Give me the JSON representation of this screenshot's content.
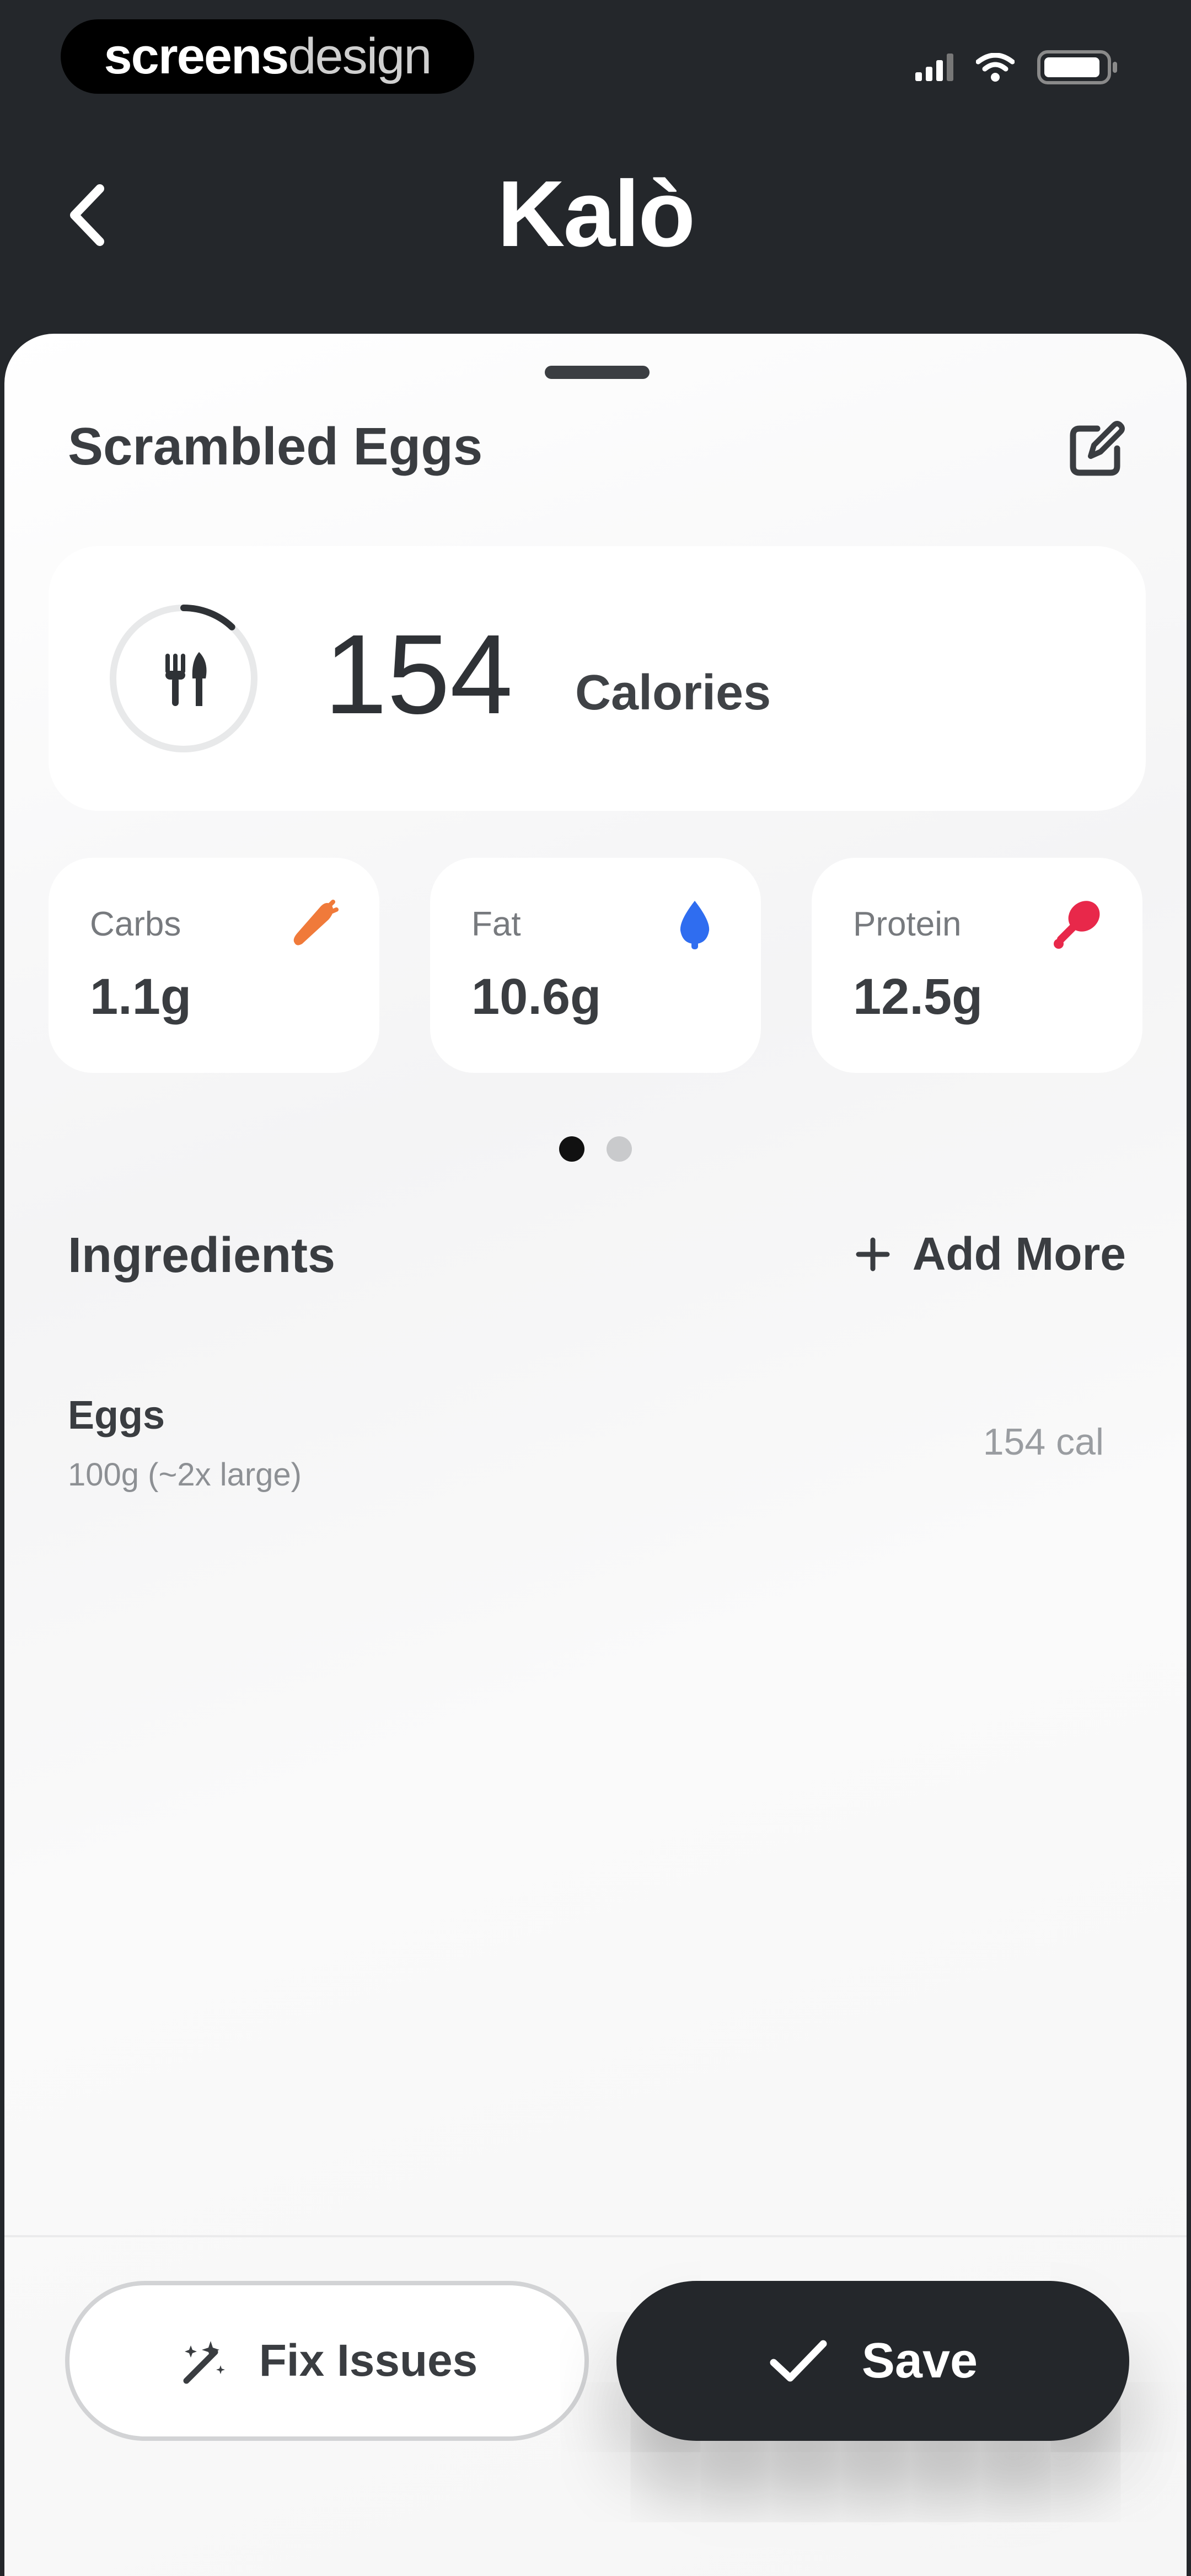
{
  "status_bar": {
    "brand_bold": "screens",
    "brand_light": "design"
  },
  "header": {
    "title": "Kalò",
    "back_icon": "chevron-left-icon"
  },
  "meal": {
    "name": "Scrambled Eggs",
    "edit_icon": "edit-icon"
  },
  "calories": {
    "value": "154",
    "label": "Calories",
    "progress_fraction": 0.12,
    "icon": "fork-knife-icon"
  },
  "macros": [
    {
      "name": "Carbs",
      "value": "1.1g",
      "icon": "carrot-icon",
      "color": "#f07a3a"
    },
    {
      "name": "Fat",
      "value": "10.6g",
      "icon": "drop-icon",
      "color": "#2f6df0"
    },
    {
      "name": "Protein",
      "value": "12.5g",
      "icon": "drumstick-icon",
      "color": "#e8284a"
    }
  ],
  "pager": {
    "pages": 2,
    "active": 0
  },
  "ingredients": {
    "title": "Ingredients",
    "add_more_label": "Add More",
    "items": [
      {
        "name": "Eggs",
        "quantity": "100g (~2x large)",
        "calories": "154 cal"
      }
    ]
  },
  "actions": {
    "fix_label": "Fix Issues",
    "save_label": "Save"
  },
  "colors": {
    "dark": "#24272b",
    "carbs": "#f07a3a",
    "fat": "#2f6df0",
    "protein": "#e8284a"
  }
}
